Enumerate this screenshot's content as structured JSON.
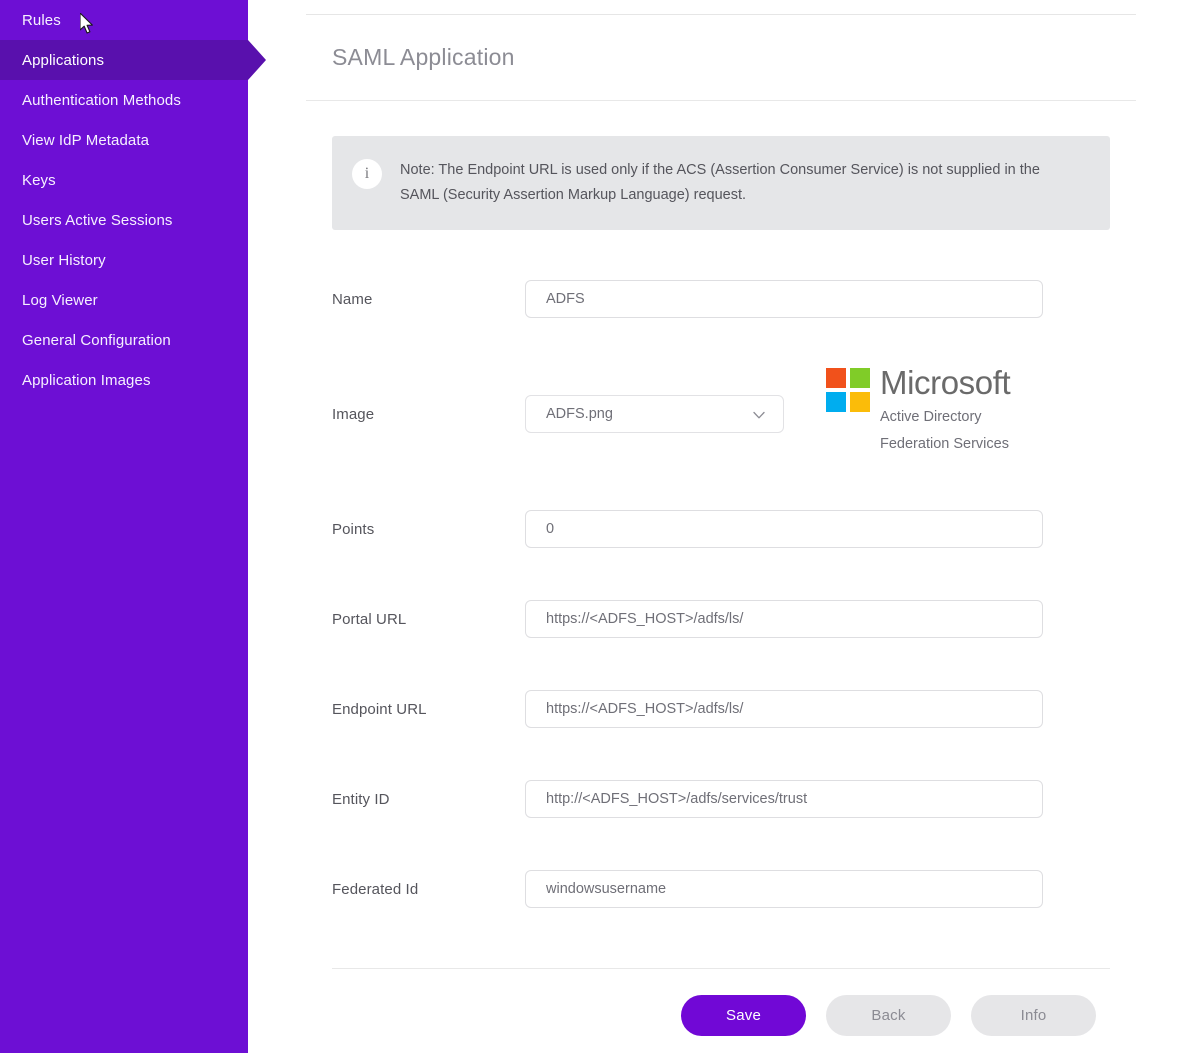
{
  "sidebar": {
    "items": [
      {
        "label": "Rules",
        "active": false
      },
      {
        "label": "Applications",
        "active": true
      },
      {
        "label": "Authentication Methods",
        "active": false
      },
      {
        "label": "View IdP Metadata",
        "active": false
      },
      {
        "label": "Keys",
        "active": false
      },
      {
        "label": "Users Active Sessions",
        "active": false
      },
      {
        "label": "User History",
        "active": false
      },
      {
        "label": "Log Viewer",
        "active": false
      },
      {
        "label": "General Configuration",
        "active": false
      },
      {
        "label": "Application Images",
        "active": false
      }
    ],
    "background_color": "#6d0fd4",
    "active_color": "#5910ad"
  },
  "header": {
    "title": "SAML Application"
  },
  "note": {
    "icon": "info-icon",
    "text": "Note: The Endpoint URL is used only if the ACS (Assertion Consumer Service) is not supplied in the SAML (Security Assertion Markup Language) request."
  },
  "form": {
    "name": {
      "label": "Name",
      "value": "ADFS"
    },
    "image": {
      "label": "Image",
      "selected": "ADFS.png",
      "dropdown_icon": "chevron-down-icon"
    },
    "points": {
      "label": "Points",
      "value": "0"
    },
    "portal_url": {
      "label": "Portal URL",
      "value": "https://<ADFS_HOST>/adfs/ls/"
    },
    "endpoint_url": {
      "label": "Endpoint URL",
      "value": "https://<ADFS_HOST>/adfs/ls/"
    },
    "entity_id": {
      "label": "Entity ID",
      "value": "http://<ADFS_HOST>/adfs/services/trust"
    },
    "federated_id": {
      "label": "Federated Id",
      "value": "windowsusername"
    }
  },
  "logo": {
    "name": "microsoft-logo",
    "wordmark": "Microsoft",
    "subtitle_line1": "Active Directory",
    "subtitle_line2": "Federation Services",
    "colors": {
      "top_left": "#f1511b",
      "top_right": "#80cc28",
      "bottom_left": "#00adef",
      "bottom_right": "#fbbc09"
    }
  },
  "footer": {
    "save_label": "Save",
    "back_label": "Back",
    "info_label": "Info",
    "primary_color": "#7108d6",
    "secondary_color": "#e6e6e8"
  }
}
